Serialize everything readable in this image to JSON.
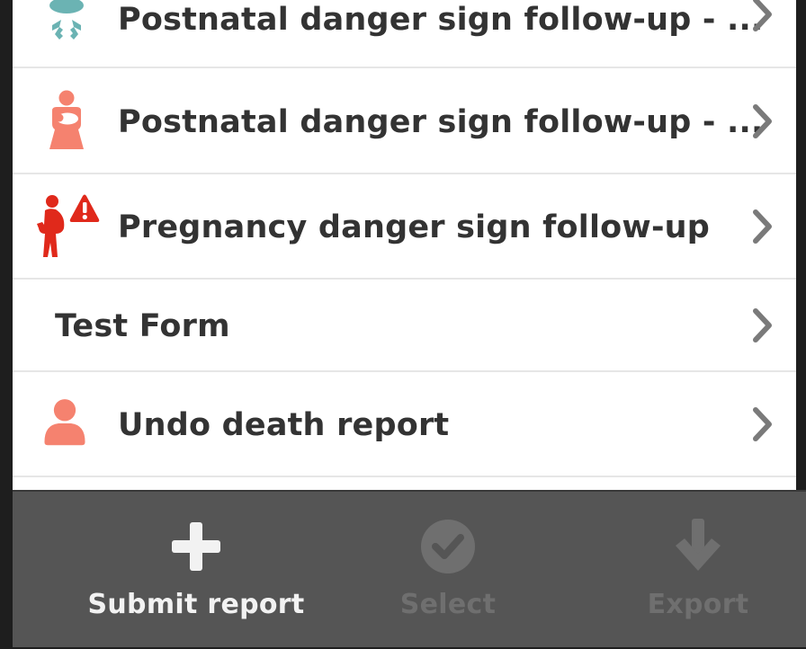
{
  "forms": [
    {
      "label": "Postnatal danger sign follow-up - ...",
      "icon": "baby-icon"
    },
    {
      "label": "Postnatal danger sign follow-up - ...",
      "icon": "mother-baby-icon"
    },
    {
      "label": "Pregnancy danger sign follow-up",
      "icon": "pregnancy-danger-icon"
    },
    {
      "label": "Test Form",
      "icon": ""
    },
    {
      "label": "Undo death report",
      "icon": "person-icon"
    }
  ],
  "toolbar": {
    "submit_label": "Submit report",
    "select_label": "Select",
    "export_label": "Export"
  },
  "colors": {
    "teal": "#6bb3b3",
    "salmon": "#f5826f",
    "red": "#e0291b",
    "text": "#333333",
    "chevron": "#7a7a7a",
    "toolbar_bg": "#555555",
    "toolbar_text": "#f2f2f2",
    "toolbar_disabled": "#6f6f6f"
  }
}
